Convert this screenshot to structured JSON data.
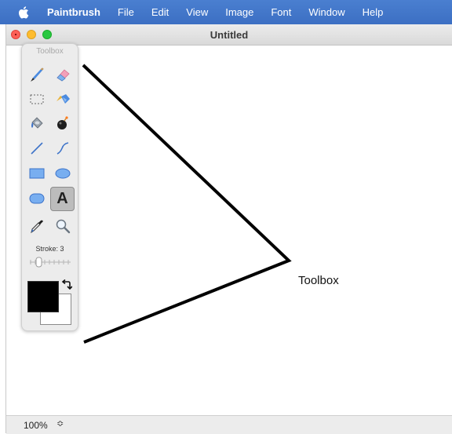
{
  "menubar": {
    "app_name": "Paintbrush",
    "items": [
      "File",
      "Edit",
      "View",
      "Image",
      "Font",
      "Window",
      "Help"
    ]
  },
  "window": {
    "title": "Untitled"
  },
  "canvas": {
    "callout_text": "Toolbox"
  },
  "toolbox": {
    "title": "Toolbox",
    "tools": [
      {
        "name": "brush",
        "icon": "brush-icon",
        "selected": false
      },
      {
        "name": "eraser",
        "icon": "eraser-icon",
        "selected": false
      },
      {
        "name": "selection",
        "icon": "selection-icon",
        "selected": false
      },
      {
        "name": "eyedropper-like fill",
        "icon": "spray-icon",
        "selected": false
      },
      {
        "name": "paint bucket",
        "icon": "paint-bucket-icon",
        "selected": false
      },
      {
        "name": "bomb",
        "icon": "bomb-icon",
        "selected": false
      },
      {
        "name": "line",
        "icon": "line-icon",
        "selected": false
      },
      {
        "name": "curve",
        "icon": "curve-icon",
        "selected": false
      },
      {
        "name": "rectangle",
        "icon": "rectangle-icon",
        "selected": false
      },
      {
        "name": "ellipse",
        "icon": "ellipse-icon",
        "selected": false
      },
      {
        "name": "rounded rectangle",
        "icon": "rounded-rectangle-icon",
        "selected": false
      },
      {
        "name": "text",
        "icon": "text-icon",
        "selected": true
      },
      {
        "name": "eyedropper",
        "icon": "eyedropper-icon",
        "selected": false
      },
      {
        "name": "zoom",
        "icon": "magnifier-icon",
        "selected": false
      }
    ],
    "text_tool_glyph": "A",
    "stroke_label": "Stroke: 3",
    "stroke_value": 3,
    "foreground_color": "#000000",
    "background_color": "#ffffff"
  },
  "statusbar": {
    "zoom": "100%",
    "zoom_stepper": "≎"
  }
}
